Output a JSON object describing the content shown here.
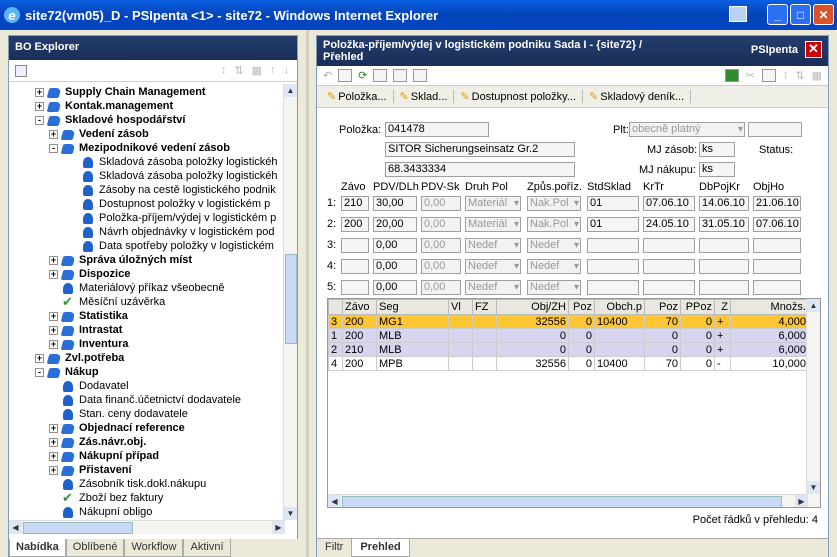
{
  "window": {
    "title": "site72(vm05)_D - PSIpenta <1> - site72 - Windows Internet Explorer"
  },
  "left": {
    "title": "BO Explorer",
    "tree": [
      {
        "label": "Supply Chain Management",
        "level": 1,
        "pm": "+",
        "icon": "blue",
        "bold": true
      },
      {
        "label": "Kontak.management",
        "level": 1,
        "pm": "+",
        "icon": "blue",
        "bold": true
      },
      {
        "label": "Skladové hospodářství",
        "level": 1,
        "pm": "-",
        "icon": "blue",
        "bold": true
      },
      {
        "label": "Vedení zásob",
        "level": 2,
        "pm": "+",
        "icon": "blue",
        "bold": true
      },
      {
        "label": "Mezipodnikové vedení zásob",
        "level": 2,
        "pm": "-",
        "icon": "blue",
        "bold": true
      },
      {
        "label": "Skladová zásoba položky logistickéh",
        "level": 3,
        "icon": "leaf"
      },
      {
        "label": "Skladová zásoba položky logistickéh",
        "level": 3,
        "icon": "leaf"
      },
      {
        "label": "Zásoby na cestě logistického podnik",
        "level": 3,
        "icon": "leaf"
      },
      {
        "label": "Dostupnost položky v logistickém p",
        "level": 3,
        "icon": "leaf"
      },
      {
        "label": "Položka-příjem/výdej v logistickém p",
        "level": 3,
        "icon": "leaf"
      },
      {
        "label": "Návrh objednávky v logistickém pod",
        "level": 3,
        "icon": "leaf"
      },
      {
        "label": "Data spotřeby položky v logistickém",
        "level": 3,
        "icon": "leaf"
      },
      {
        "label": "Správa úložných míst",
        "level": 2,
        "pm": "+",
        "icon": "blue",
        "bold": true
      },
      {
        "label": "Dispozice",
        "level": 2,
        "pm": "+",
        "icon": "blue",
        "bold": true
      },
      {
        "label": "Materiálový příkaz všeobecně",
        "level": 2,
        "icon": "leaf"
      },
      {
        "label": "Měsíční uzávěrka",
        "level": 2,
        "icon": "check"
      },
      {
        "label": "Statistika",
        "level": 2,
        "pm": "+",
        "icon": "blue",
        "bold": true
      },
      {
        "label": "Intrastat",
        "level": 2,
        "pm": "+",
        "icon": "blue",
        "bold": true
      },
      {
        "label": "Inventura",
        "level": 2,
        "pm": "+",
        "icon": "blue",
        "bold": true
      },
      {
        "label": "Zvl.potřeba",
        "level": 1,
        "pm": "+",
        "icon": "blue",
        "bold": true
      },
      {
        "label": "Nákup",
        "level": 1,
        "pm": "-",
        "icon": "blue",
        "bold": true
      },
      {
        "label": "Dodavatel",
        "level": 2,
        "icon": "leaf"
      },
      {
        "label": "Data finanč.účetnictví dodavatele",
        "level": 2,
        "icon": "leaf"
      },
      {
        "label": "Stan. ceny dodavatele",
        "level": 2,
        "icon": "leaf"
      },
      {
        "label": "Objednací reference",
        "level": 2,
        "pm": "+",
        "icon": "blue",
        "bold": true
      },
      {
        "label": "Zás.návr.obj.",
        "level": 2,
        "pm": "+",
        "icon": "blue",
        "bold": true
      },
      {
        "label": "Nákupní případ",
        "level": 2,
        "pm": "+",
        "icon": "blue",
        "bold": true
      },
      {
        "label": "Přistavení",
        "level": 2,
        "pm": "+",
        "icon": "blue",
        "bold": true
      },
      {
        "label": "Zásobník tisk.dokl.nákupu",
        "level": 2,
        "icon": "leaf"
      },
      {
        "label": "Zboží bez faktury",
        "level": 2,
        "icon": "check"
      },
      {
        "label": "Nákupní obligo",
        "level": 2,
        "icon": "leaf"
      }
    ],
    "tabs": [
      "Nabídka",
      "Oblíbené",
      "Workflow",
      "Aktivní"
    ]
  },
  "right": {
    "title_line1": "Položka-příjem/výdej v logistickém podniku  Sada I - {site72} /",
    "title_line2": "Přehled",
    "brand": "PSIpenta",
    "links": [
      "Položka...",
      "Sklad...",
      "Dostupnost položky...",
      "Skladový deník..."
    ],
    "form": {
      "polozka_label": "Položka:",
      "polozka": "041478",
      "plt_label": "Plt:",
      "plt": "obecně platný",
      "name": "SITOR Sicherungseinsatz Gr.2",
      "code": "68.3433334",
      "mj_zasob_label": "MJ zásob:",
      "mj_zasob": "ks",
      "status_label": "Status:",
      "mj_nakupu_label": "MJ nákupu:",
      "mj_nakupu": "ks",
      "cols": [
        "Závo",
        "PDV/DLh",
        "PDV-Sk",
        "Druh Pol",
        "Způs.poříz.",
        "StdSklad",
        "KrTr",
        "DbPojKr",
        "ObjHo"
      ],
      "rows": [
        {
          "n": "1:",
          "zavo": "210",
          "pdv": "30,00",
          "pdvsk": "0,00",
          "druh": "Materiál",
          "zpus": "Nak.Pol",
          "std": "01",
          "krtr": "07.06.10",
          "db": "14.06.10",
          "obj": "21.06.10"
        },
        {
          "n": "2:",
          "zavo": "200",
          "pdv": "20,00",
          "pdvsk": "0,00",
          "druh": "Materiál",
          "zpus": "Nak.Pol",
          "std": "01",
          "krtr": "24.05.10",
          "db": "31.05.10",
          "obj": "07.06.10"
        },
        {
          "n": "3:",
          "zavo": "",
          "pdv": "0,00",
          "pdvsk": "0,00",
          "druh": "Nedef",
          "zpus": "Nedef",
          "std": "",
          "krtr": "",
          "db": "",
          "obj": ""
        },
        {
          "n": "4:",
          "zavo": "",
          "pdv": "0,00",
          "pdvsk": "0,00",
          "druh": "Nedef",
          "zpus": "Nedef",
          "std": "",
          "krtr": "",
          "db": "",
          "obj": ""
        },
        {
          "n": "5:",
          "zavo": "",
          "pdv": "0,00",
          "pdvsk": "0,00",
          "druh": "Nedef",
          "zpus": "Nedef",
          "std": "",
          "krtr": "",
          "db": "",
          "obj": ""
        }
      ]
    },
    "grid": {
      "headers": [
        "",
        "Závo",
        "Seg",
        "Vl",
        "FZ",
        "Obj/ZH",
        "Poz",
        "Obch.p",
        "Poz",
        "PPoz",
        "Z",
        "Množs."
      ],
      "rows": [
        {
          "cls": "hl",
          "cells": [
            "3",
            "200",
            "MG1",
            "",
            "",
            "32556",
            "0",
            "10400",
            "70",
            "0",
            "+",
            "4,000"
          ]
        },
        {
          "cls": "lv",
          "cells": [
            "1",
            "200",
            "MLB",
            "",
            "",
            "0",
            "0",
            "",
            "0",
            "0",
            "+",
            "6,000"
          ]
        },
        {
          "cls": "lv",
          "cells": [
            "2",
            "210",
            "MLB",
            "",
            "",
            "0",
            "0",
            "",
            "0",
            "0",
            "+",
            "6,000"
          ]
        },
        {
          "cls": "w",
          "cells": [
            "4",
            "200",
            "MPB",
            "",
            "",
            "32556",
            "0",
            "10400",
            "70",
            "0",
            "-",
            "10,000"
          ]
        }
      ]
    },
    "rowcount": "Počet řádků v přehledu: 4",
    "tabs": [
      "Filtr",
      "Prehled"
    ]
  }
}
